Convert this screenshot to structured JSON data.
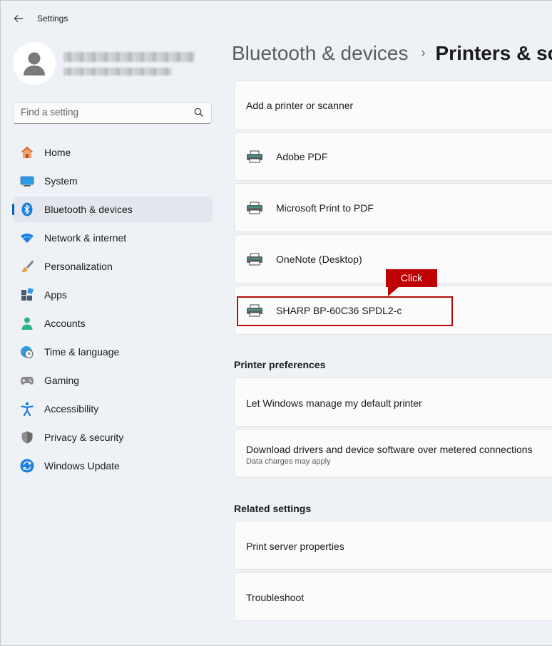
{
  "window": {
    "title": "Settings"
  },
  "search": {
    "placeholder": "Find a setting"
  },
  "sidebar": {
    "items": [
      {
        "label": "Home",
        "icon": "home-icon"
      },
      {
        "label": "System",
        "icon": "system-icon"
      },
      {
        "label": "Bluetooth & devices",
        "icon": "bluetooth-icon",
        "active": true
      },
      {
        "label": "Network & internet",
        "icon": "wifi-icon"
      },
      {
        "label": "Personalization",
        "icon": "brush-icon"
      },
      {
        "label": "Apps",
        "icon": "apps-icon"
      },
      {
        "label": "Accounts",
        "icon": "account-icon"
      },
      {
        "label": "Time & language",
        "icon": "globe-clock-icon"
      },
      {
        "label": "Gaming",
        "icon": "gamepad-icon"
      },
      {
        "label": "Accessibility",
        "icon": "accessibility-icon"
      },
      {
        "label": "Privacy & security",
        "icon": "shield-icon"
      },
      {
        "label": "Windows Update",
        "icon": "update-icon"
      }
    ]
  },
  "breadcrumb": {
    "parent": "Bluetooth & devices",
    "separator": "›",
    "current": "Printers & sc"
  },
  "printers": {
    "add_label": "Add a printer or scanner",
    "list": [
      "Adobe PDF",
      "Microsoft Print to PDF",
      "OneNote (Desktop)",
      "SHARP BP-60C36 SPDL2-c"
    ]
  },
  "preferences": {
    "title": "Printer preferences",
    "items": [
      {
        "label": "Let Windows manage my default printer"
      },
      {
        "label": "Download drivers and device software over metered connections",
        "sub": "Data charges may apply"
      }
    ]
  },
  "related": {
    "title": "Related settings",
    "items": [
      "Print server properties",
      "Troubleshoot"
    ]
  },
  "annotation": {
    "callout": "Click",
    "color": "#c00000"
  },
  "colors": {
    "accent": "#005fb8",
    "background": "#eef1f6",
    "card": "#fbfbfb"
  }
}
